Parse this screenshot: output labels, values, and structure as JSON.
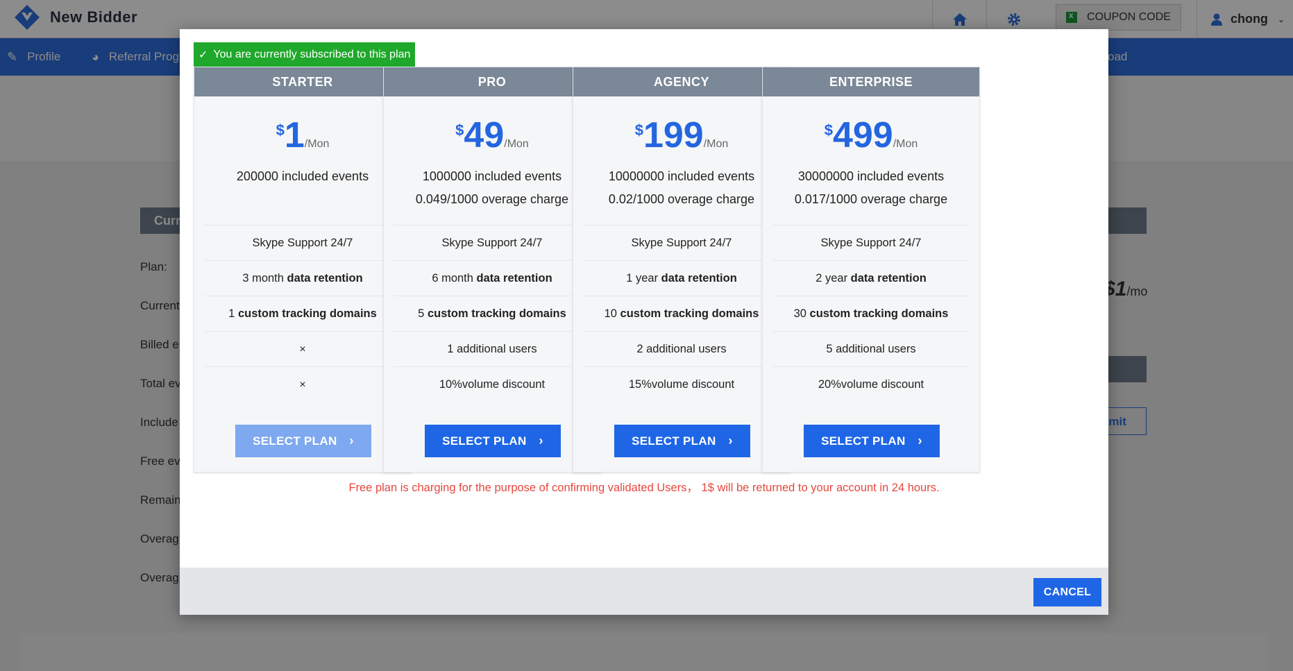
{
  "app": {
    "name": "New Bidder"
  },
  "topbar": {
    "coupon_label": "COUPON CODE",
    "user_name": "chong",
    "colors": {
      "accent": "#2f6fde",
      "logo": "#2f6fde"
    }
  },
  "nav": {
    "items": [
      {
        "label": "Profile",
        "icon": "edit-icon"
      },
      {
        "label": "Referral Prog",
        "icon": "referral-icon"
      },
      {
        "label": "oad",
        "icon": ""
      }
    ]
  },
  "background": {
    "card_header": "Curr",
    "labels": [
      "Plan:",
      "Current",
      "Billed e",
      "Total ev",
      "Include",
      "Free ev",
      "Remain",
      "Overag",
      "Overag"
    ],
    "price_fragment": "$1",
    "price_unit": "/mo",
    "submit_fragment": "bmit"
  },
  "modal": {
    "current_badge": "You are currently subscribed to this plan",
    "plans": [
      {
        "name": "STARTER",
        "currency": "$",
        "price": "1",
        "period": "/Mon",
        "events_line1": "200000 included events",
        "events_line2": "",
        "support": "Skype Support 24/7",
        "retention_prefix": "3 month",
        "retention_label": "data retention",
        "domains_count": "1",
        "domains_label": "custom tracking domains",
        "users": "×",
        "discount": "×",
        "button": "SELECT PLAN",
        "disabled": true
      },
      {
        "name": "PRO",
        "currency": "$",
        "price": "49",
        "period": "/Mon",
        "events_line1": "1000000 included events",
        "events_line2": "0.049/1000 overage charge",
        "support": "Skype Support 24/7",
        "retention_prefix": "6 month",
        "retention_label": "data retention",
        "domains_count": "5",
        "domains_label": "custom tracking domains",
        "users": "1 additional users",
        "discount": "10%volume discount",
        "button": "SELECT PLAN",
        "disabled": false
      },
      {
        "name": "AGENCY",
        "currency": "$",
        "price": "199",
        "period": "/Mon",
        "events_line1": "10000000 included events",
        "events_line2": "0.02/1000 overage charge",
        "support": "Skype Support 24/7",
        "retention_prefix": "1 year",
        "retention_label": "data retention",
        "domains_count": "10",
        "domains_label": "custom tracking domains",
        "users": "2 additional users",
        "discount": "15%volume discount",
        "button": "SELECT PLAN",
        "disabled": false
      },
      {
        "name": "ENTERPRISE",
        "currency": "$",
        "price": "499",
        "period": "/Mon",
        "events_line1": "30000000 included events",
        "events_line2": "0.017/1000 overage charge",
        "support": "Skype Support 24/7",
        "retention_prefix": "2 year",
        "retention_label": "data retention",
        "domains_count": "30",
        "domains_label": "custom tracking domains",
        "users": "5 additional users",
        "discount": "20%volume discount",
        "button": "SELECT PLAN",
        "disabled": false
      }
    ],
    "notice": "Free plan is charging for the purpose of confirming validated Users， 1$ will be returned to your account in 24 hours.",
    "cancel_label": "CANCEL",
    "colors": {
      "primary": "#1f66e6",
      "disabled": "#7ea8ef",
      "success": "#1fa82b",
      "warning_text": "#e5483e",
      "plan_header": "#7b8897"
    }
  }
}
